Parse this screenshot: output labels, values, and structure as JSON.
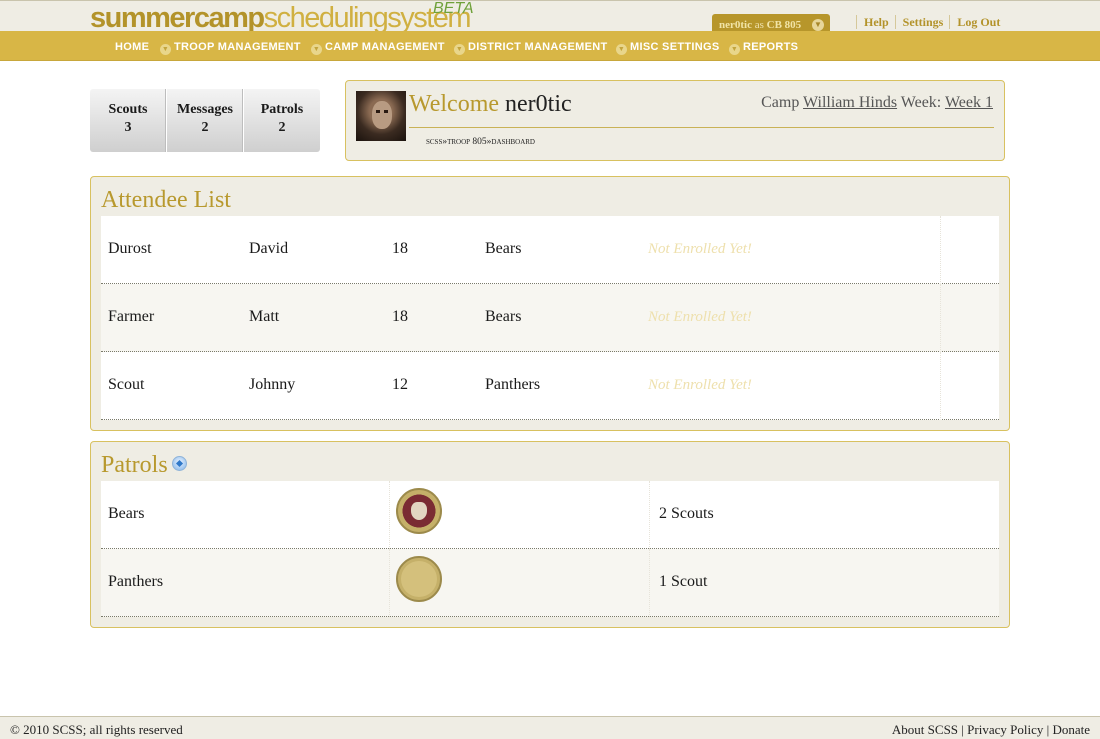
{
  "header": {
    "logo": {
      "part1": "summercamp",
      "part2": "schedulingsystem",
      "badge": "BETA"
    },
    "user_badge": {
      "user": "ner0tic",
      "as": "as",
      "troop": "CB 805"
    },
    "top_links": [
      "Help",
      "Settings",
      "Log Out"
    ]
  },
  "nav": {
    "items": [
      "HOME",
      "TROOP MANAGEMENT",
      "CAMP MANAGEMENT",
      "DISTRICT MANAGEMENT",
      "MISC SETTINGS",
      "REPORTS"
    ]
  },
  "stats": [
    {
      "label": "Scouts",
      "count": "3"
    },
    {
      "label": "Messages",
      "count": "2"
    },
    {
      "label": "Patrols",
      "count": "2"
    }
  ],
  "welcome": {
    "greeting": "Welcome",
    "username": "ner0tic",
    "camp_label": "Camp",
    "camp_name": "William Hinds",
    "week_label": "Week:",
    "week_value": "Week 1",
    "breadcrumb": "scss»troop 805»dashboard"
  },
  "attendees": {
    "title": "Attendee List",
    "rows": [
      {
        "last": "Durost",
        "first": "David",
        "age": "18",
        "patrol": "Bears",
        "status": "Not Enrolled Yet!"
      },
      {
        "last": "Farmer",
        "first": "Matt",
        "age": "18",
        "patrol": "Bears",
        "status": "Not Enrolled Yet!"
      },
      {
        "last": "Scout",
        "first": "Johnny",
        "age": "12",
        "patrol": "Panthers",
        "status": "Not Enrolled Yet!"
      }
    ]
  },
  "patrols": {
    "title": "Patrols",
    "rows": [
      {
        "name": "Bears",
        "count": "2 Scouts"
      },
      {
        "name": "Panthers",
        "count": "1 Scout"
      }
    ]
  },
  "footer": {
    "copyright": "© 2010 SCSS; all rights reserved",
    "links": [
      "About SCSS",
      "Privacy Policy",
      "Donate"
    ],
    "separator": "|"
  }
}
